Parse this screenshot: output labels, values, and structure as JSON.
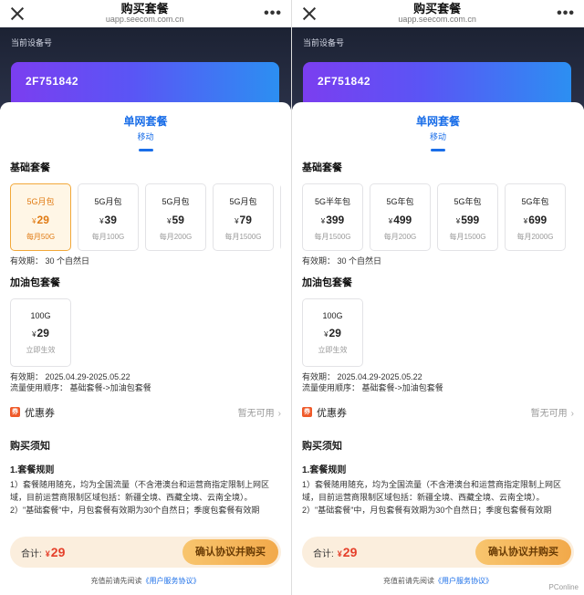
{
  "watermark": "PConline",
  "panes": [
    {
      "titlebar": {
        "title": "购买套餐",
        "url": "uapp.seecom.com.cn",
        "more": "•••"
      },
      "hero": {
        "label": "当前设备号",
        "device_id": "2F751842"
      },
      "tab": {
        "name": "单网套餐",
        "sub": "移动"
      },
      "basic": {
        "title": "基础套餐",
        "plans": [
          {
            "name": "5G月包",
            "currency": "¥",
            "price": "29",
            "sub": "每月50G"
          },
          {
            "name": "5G月包",
            "currency": "¥",
            "price": "39",
            "sub": "每月100G"
          },
          {
            "name": "5G月包",
            "currency": "¥",
            "price": "59",
            "sub": "每月200G"
          },
          {
            "name": "5G月包",
            "currency": "¥",
            "price": "79",
            "sub": "每月1500G"
          }
        ],
        "validity": "有效期：  30 个自然日"
      },
      "addon": {
        "title": "加油包套餐",
        "name": "100G",
        "currency": "¥",
        "price": "29",
        "sub": "立即生效",
        "validity": "有效期：  2025.04.29-2025.05.22",
        "order": "流量使用顺序：  基础套餐->加油包套餐"
      },
      "coupon": {
        "label": "优惠券",
        "icon": "券",
        "status": "暂无可用"
      },
      "notice": {
        "title": "购买须知",
        "rule_title": "1.套餐规则",
        "rule_1": "1）套餐随用随充，均为全国流量（不含港澳台和运营商指定限制上网区域，目前运营商限制区域包括：新疆全境、西藏全境、云南全境）。",
        "rule_2": "2）\"基础套餐\"中，月包套餐有效期为30个自然日；季度包套餐有效期"
      },
      "footer": {
        "total_label": "合计:",
        "currency": "¥",
        "total": "29",
        "pay": "确认协议并购买",
        "agree_prefix": "充值前请先阅读",
        "agree_link": "《用户服务协议》"
      }
    },
    {
      "titlebar": {
        "title": "购买套餐",
        "url": "uapp.seecom.com.cn",
        "more": "•••"
      },
      "hero": {
        "label": "当前设备号",
        "device_id": "2F751842"
      },
      "tab": {
        "name": "单网套餐",
        "sub": "移动"
      },
      "basic": {
        "title": "基础套餐",
        "plans": [
          {
            "name": "5G半年包",
            "currency": "¥",
            "price": "399",
            "sub": "每月1500G"
          },
          {
            "name": "5G年包",
            "currency": "¥",
            "price": "499",
            "sub": "每月200G"
          },
          {
            "name": "5G年包",
            "currency": "¥",
            "price": "599",
            "sub": "每月1500G"
          },
          {
            "name": "5G年包",
            "currency": "¥",
            "price": "699",
            "sub": "每月2000G"
          }
        ],
        "validity": "有效期：  30 个自然日"
      },
      "addon": {
        "title": "加油包套餐",
        "name": "100G",
        "currency": "¥",
        "price": "29",
        "sub": "立即生效",
        "validity": "有效期：  2025.04.29-2025.05.22",
        "order": "流量使用顺序：  基础套餐->加油包套餐"
      },
      "coupon": {
        "label": "优惠券",
        "icon": "券",
        "status": "暂无可用"
      },
      "notice": {
        "title": "购买须知",
        "rule_title": "1.套餐规则",
        "rule_1": "1）套餐随用随充，均为全国流量（不含港澳台和运营商指定限制上网区域，目前运营商限制区域包括：新疆全境、西藏全境、云南全境）。",
        "rule_2": "2）\"基础套餐\"中，月包套餐有效期为30个自然日；季度包套餐有效期"
      },
      "footer": {
        "total_label": "合计:",
        "currency": "¥",
        "total": "29",
        "pay": "确认协议并购买",
        "agree_prefix": "充值前请先阅读",
        "agree_link": "《用户服务协议》"
      }
    }
  ]
}
